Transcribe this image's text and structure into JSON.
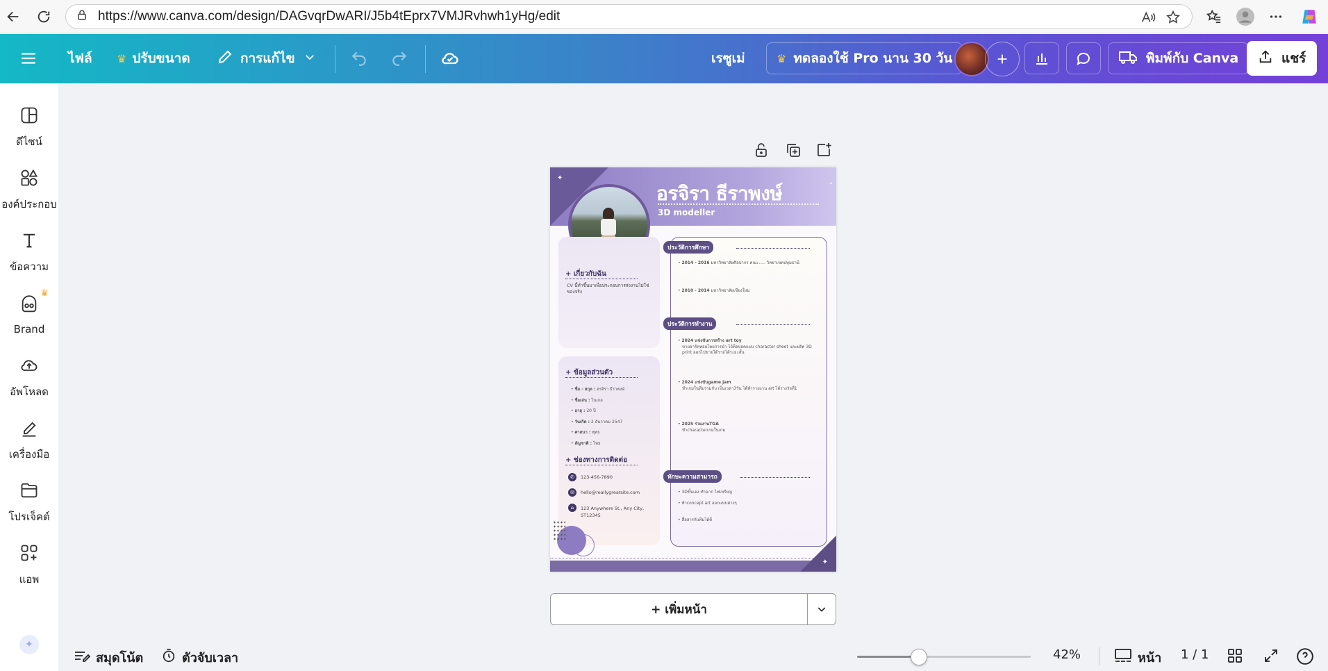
{
  "browser": {
    "url": "https://www.canva.com/design/DAGvqrDwARI/J5b4tEprx7VMJRvhwh1yHg/edit",
    "icons": [
      "back-icon",
      "reload-icon",
      "site-info-icon",
      "read-aloud-icon",
      "favorite-star-icon",
      "favorites-icon",
      "profile-icon",
      "more-icon",
      "copilot-icon"
    ]
  },
  "toolbar": {
    "file": "ไฟล์",
    "resize": "ปรับขนาด",
    "editing": "การแก้ไข",
    "resume": "เรซูเม่",
    "trial": "ทดลองใช้ Pro นาน 30 วัน",
    "print": "พิมพ์กับ Canva",
    "share": "แชร์"
  },
  "sidebar": {
    "items": [
      {
        "label": "ดีไซน์",
        "icon": "design-icon"
      },
      {
        "label": "องค์ประกอบ",
        "icon": "elements-icon"
      },
      {
        "label": "ข้อความ",
        "icon": "text-icon"
      },
      {
        "label": "Brand",
        "icon": "brand-icon"
      },
      {
        "label": "อัพโหลด",
        "icon": "upload-icon"
      },
      {
        "label": "เครื่องมือ",
        "icon": "tools-icon"
      },
      {
        "label": "โปรเจ็คต์",
        "icon": "projects-icon"
      },
      {
        "label": "แอพ",
        "icon": "apps-icon"
      }
    ]
  },
  "resume": {
    "name": "อรจิรา ธีราพงษ์",
    "title": "3D modeller",
    "about_heading": "+ เกี่ยวกับฉัน",
    "about_text": "CV นี้ทำขึ้นมาเพื่อประกอบการส่งงานไม่ใช่ของจริง",
    "personal_heading": "+ ข้อมูลส่วนตัว",
    "personal": [
      {
        "k": "ชื่อ - สกุล :",
        "v": "อรจิรา ธีราพงษ์"
      },
      {
        "k": "ชื่อเล่น :",
        "v": "ไนเกล"
      },
      {
        "k": "อายุ :",
        "v": "20 ปี"
      },
      {
        "k": "วันเกิด :",
        "v": "2 ธันวาคม 2547"
      },
      {
        "k": "ศาสนา :",
        "v": "พุทธ"
      },
      {
        "k": "สัญชาติ :",
        "v": "ไทย"
      }
    ],
    "contact_heading": "+ ช่องทางการติดต่อ",
    "phone": "123-456-7890",
    "email": "hello@reallygreatsite.com",
    "address": "123 Anywhere St., Any City, ST12345",
    "edu_heading": "ประวัติการศึกษา",
    "edu": [
      {
        "year": "2014 - 2016",
        "text": "มหาวิทยาลัยศิลปากร คณะ..... วิทยาเขตปทุมธานี"
      },
      {
        "year": "2010 - 2014",
        "text": "มหาวิทยาลัยเชียงใหม่"
      }
    ],
    "work_heading": "ประวัติการทำงาน",
    "work": [
      {
        "title": "2024 แข่งขันการสร้าง art toy",
        "text": "ขายอาร์ตทอยโดยการนำ ไอ้ท็อปอคแบบ character sheet และผลิต 3D print ออกไปขายได้รายได้ระยะสั้น"
      },
      {
        "title": "2024 แข่งขันgame jam",
        "text": "ทำเกมในทีมร่วมกับ เป็นเวลา3วัน ได้ทำรายงาน art ได้รางวัลที่1"
      },
      {
        "title": "2025 ร่วมงานTGA",
        "text": "ทำcharacterเกมในเกม"
      }
    ],
    "skills_heading": "ทักษะความสามารถ",
    "skills": [
      "3Dขึ้นเอง ทำฉาก ไฟเหรียญ",
      "ทำconcept art ออกแบบต่างๆ",
      "สื่อสารกับทีมได้ดี"
    ]
  },
  "canvas": {
    "add_page": "+ เพิ่มหน้า"
  },
  "bottom": {
    "notes": "สมุดโน้ต",
    "timer": "ตัวจับเวลา",
    "zoom": "42%",
    "zoom_level": 0.42,
    "pages_label": "หน้า",
    "page_count": "1 / 1"
  }
}
